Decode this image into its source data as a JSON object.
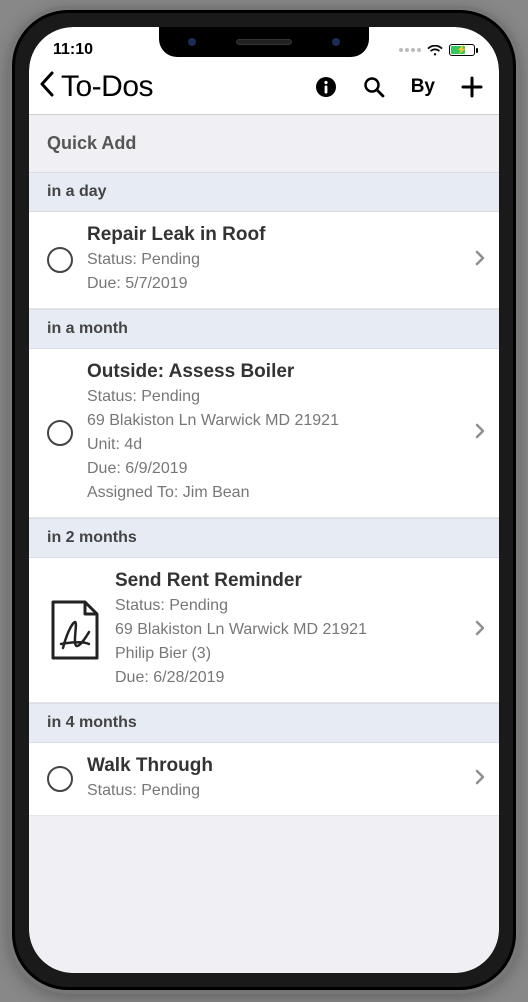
{
  "status_bar": {
    "time": "11:10"
  },
  "nav": {
    "title": "To-Dos",
    "action_by": "By"
  },
  "quick_add": {
    "label": "Quick Add"
  },
  "sections": [
    {
      "header": "in a day",
      "items": [
        {
          "icon": "circle",
          "title": "Repair Leak in Roof",
          "lines": [
            "Status: Pending",
            "Due: 5/7/2019"
          ]
        }
      ]
    },
    {
      "header": "in a month",
      "items": [
        {
          "icon": "circle",
          "title": "Outside: Assess Boiler",
          "lines": [
            "Status: Pending",
            "69 Blakiston Ln Warwick MD 21921",
            "Unit: 4d",
            "Due: 6/9/2019",
            "Assigned To: Jim Bean"
          ]
        }
      ]
    },
    {
      "header": "in 2 months",
      "items": [
        {
          "icon": "pdf",
          "title": "Send Rent Reminder",
          "lines": [
            "Status: Pending",
            "69 Blakiston Ln Warwick MD 21921",
            "Philip Bier (3)",
            "Due: 6/28/2019"
          ]
        }
      ]
    },
    {
      "header": "in 4 months",
      "items": [
        {
          "icon": "circle",
          "title": "Walk Through",
          "lines": [
            "Status: Pending"
          ]
        }
      ]
    }
  ]
}
